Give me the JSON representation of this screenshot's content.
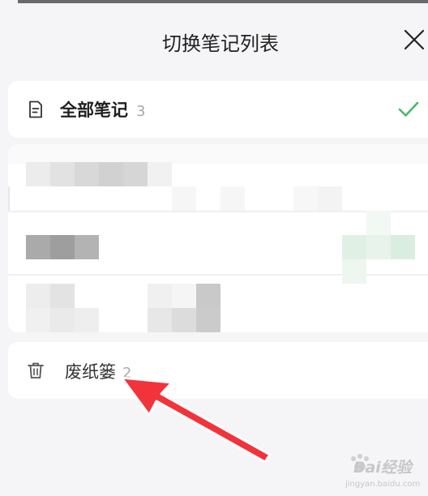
{
  "header": {
    "title": "切换笔记列表"
  },
  "notebooks": {
    "all": {
      "label": "全部笔记",
      "count": "3",
      "selected": true
    },
    "trash": {
      "label": "废纸篓",
      "count": "2"
    }
  },
  "watermark": {
    "brand": "Bai",
    "brand2": "经验",
    "domain": "jingyan.baidu.com"
  },
  "colors": {
    "accent": "#4cb86a",
    "annotation_arrow": "#f2333b"
  },
  "icons": {
    "close": "close-icon",
    "note": "note-icon",
    "check": "check-icon",
    "trash": "trash-icon"
  }
}
